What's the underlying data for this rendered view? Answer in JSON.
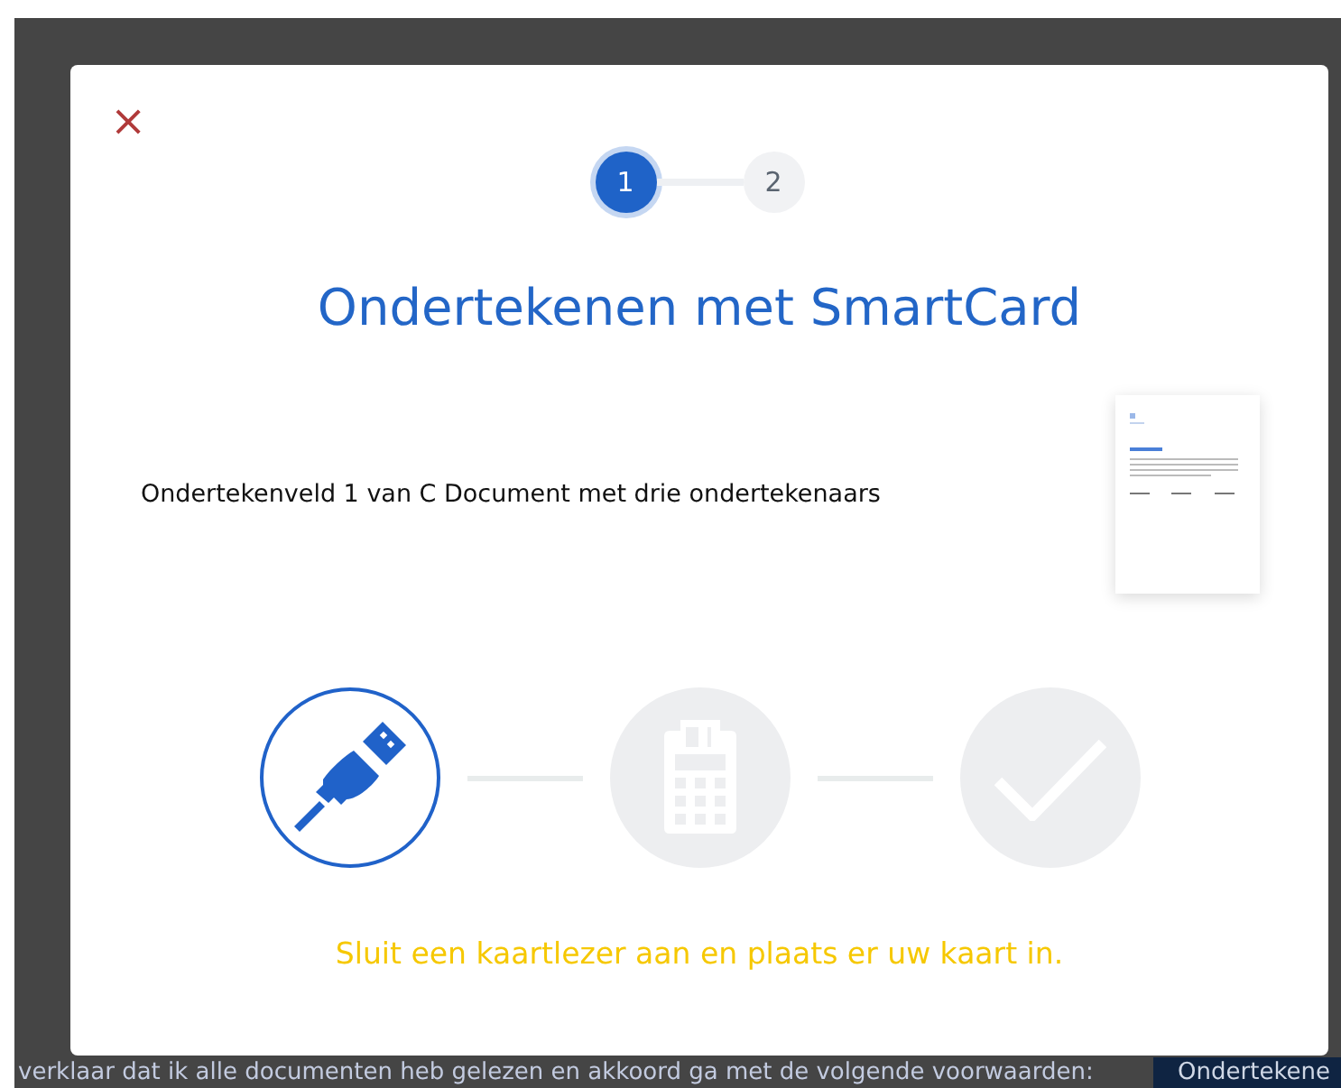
{
  "background": {
    "statement": "verklaar dat ik alle documenten heb gelezen en akkoord ga met de volgende voorwaarden:",
    "button": "Ondertekene"
  },
  "dialog": {
    "close": "×",
    "steps": [
      {
        "label": "1",
        "selected": true
      },
      {
        "label": "2",
        "selected": false
      }
    ],
    "title": "Ondertekenen met SmartCard",
    "field_text": "Ondertekenveld 1 van C Document met drie ondertekenaars",
    "stages": [
      {
        "kind": "usb",
        "selected": true
      },
      {
        "kind": "reader",
        "selected": false
      },
      {
        "kind": "check",
        "selected": false
      }
    ],
    "message": "Sluit een kaartlezer aan en plaats er uw kaart in."
  }
}
